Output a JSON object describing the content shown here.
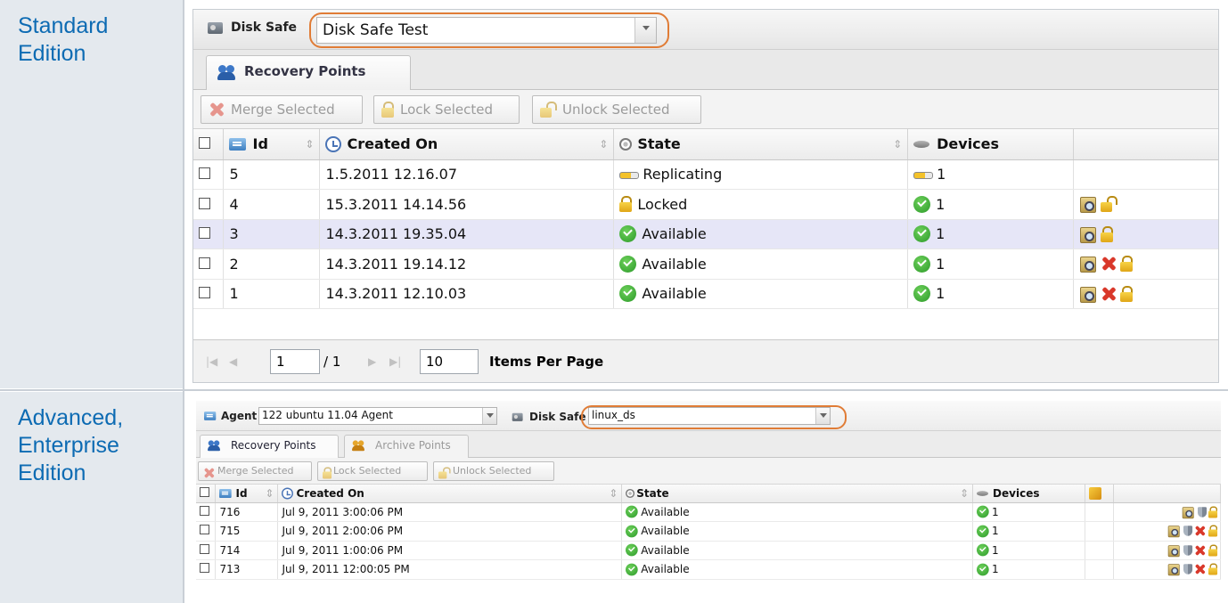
{
  "rows_labels": {
    "standard": [
      "Standard",
      "Edition"
    ],
    "advanced": [
      "Advanced,",
      "Enterprise",
      "Edition"
    ]
  },
  "standard": {
    "disk_safe_label": "Disk Safe",
    "disk_safe_value": "Disk Safe Test",
    "tab_recovery": "Recovery Points",
    "toolbar": {
      "merge": "Merge Selected",
      "lock": "Lock Selected",
      "unlock": "Unlock Selected"
    },
    "columns": {
      "id": "Id",
      "created": "Created On",
      "state": "State",
      "devices": "Devices"
    },
    "rows": [
      {
        "id": "5",
        "created": "1.5.2011 12.16.07",
        "state": "Replicating",
        "state_icon": "progress-bar-icon",
        "devices": "1",
        "device_icon": "progress-bar-icon",
        "actions": []
      },
      {
        "id": "4",
        "created": "15.3.2011 14.14.56",
        "state": "Locked",
        "state_icon": "lock-icon",
        "devices": "1",
        "device_icon": "check-icon",
        "actions": [
          "browse",
          "unlock"
        ]
      },
      {
        "id": "3",
        "created": "14.3.2011 19.35.04",
        "state": "Available",
        "state_icon": "check-icon",
        "devices": "1",
        "device_icon": "check-icon",
        "actions": [
          "browse",
          "lock"
        ],
        "selected": true
      },
      {
        "id": "2",
        "created": "14.3.2011 19.14.12",
        "state": "Available",
        "state_icon": "check-icon",
        "devices": "1",
        "device_icon": "check-icon",
        "actions": [
          "browse",
          "delete",
          "lock"
        ]
      },
      {
        "id": "1",
        "created": "14.3.2011 12.10.03",
        "state": "Available",
        "state_icon": "check-icon",
        "devices": "1",
        "device_icon": "check-icon",
        "actions": [
          "browse",
          "delete",
          "lock"
        ]
      }
    ],
    "pager": {
      "page": "1",
      "of_total": "/ 1",
      "per_page": "10",
      "per_page_label": "Items Per Page"
    }
  },
  "advanced": {
    "agent_label": "Agent",
    "agent_value": "122 ubuntu 11.04 Agent",
    "disk_safe_label": "Disk Safe",
    "disk_safe_value": "linux_ds",
    "tab_recovery": "Recovery Points",
    "tab_archive": "Archive Points",
    "toolbar": {
      "merge": "Merge Selected",
      "lock": "Lock Selected",
      "unlock": "Unlock Selected"
    },
    "columns": {
      "id": "Id",
      "created": "Created On",
      "state": "State",
      "devices": "Devices"
    },
    "rows": [
      {
        "id": "716",
        "created": "Jul 9, 2011 3:00:06 PM",
        "state": "Available",
        "devices": "1",
        "actions": [
          "browse",
          "shield",
          "lock"
        ]
      },
      {
        "id": "715",
        "created": "Jul 9, 2011 2:00:06 PM",
        "state": "Available",
        "devices": "1",
        "actions": [
          "browse",
          "shield",
          "delete",
          "lock"
        ]
      },
      {
        "id": "714",
        "created": "Jul 9, 2011 1:00:06 PM",
        "state": "Available",
        "devices": "1",
        "actions": [
          "browse",
          "shield",
          "delete",
          "lock"
        ]
      },
      {
        "id": "713",
        "created": "Jul 9, 2011 12:00:05 PM",
        "state": "Available",
        "devices": "1",
        "actions": [
          "browse",
          "shield",
          "delete",
          "lock"
        ]
      }
    ]
  },
  "colors": {
    "label_text": "#0d6bb3",
    "label_bg": "#e4e9ee",
    "highlight": "#e07c36",
    "selected_row": "#e6e6f7"
  }
}
